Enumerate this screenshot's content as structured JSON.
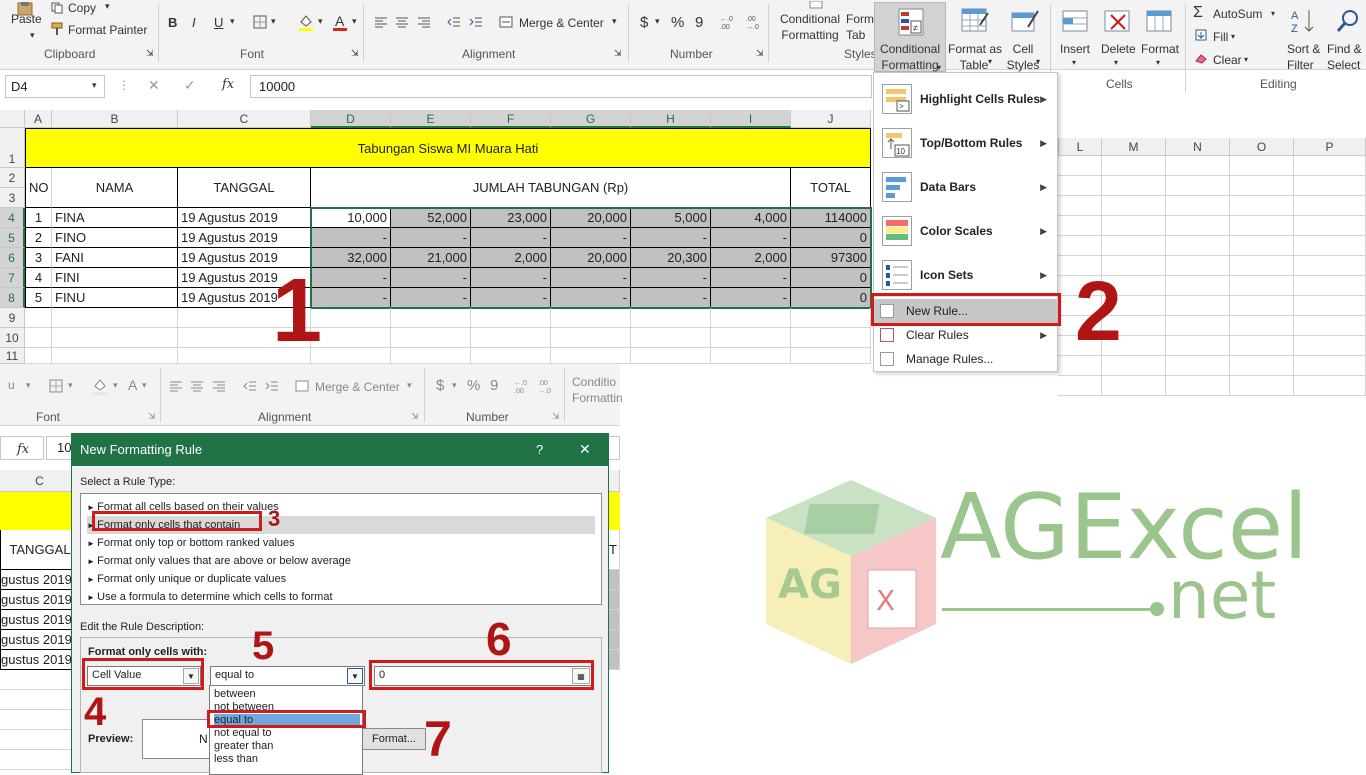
{
  "ribbon": {
    "clipboard": {
      "paste": "Paste",
      "copy": "Copy",
      "format_painter": "Format Painter",
      "label": "Clipboard"
    },
    "font": {
      "label": "Font",
      "bold": "B",
      "italic": "I",
      "underline": "U"
    },
    "alignment": {
      "merge_center": "Merge & Center",
      "label": "Alignment"
    },
    "number": {
      "currency": "$",
      "percent": "%",
      "comma": "9",
      "label": "Number"
    },
    "styles": {
      "conditional_formatting_back": "Conditional\nFormatting",
      "format_table_back": "Form\nTab",
      "label": "Styles"
    },
    "cf_button": "Conditional\nFormatting",
    "format_as_table": "Format as\nTable",
    "cell_styles": "Cell\nStyles",
    "cells": {
      "insert": "Insert",
      "delete": "Delete",
      "format": "Format",
      "label": "Cells"
    },
    "editing": {
      "autosum": "AutoSum",
      "fill": "Fill",
      "clear": "Clear",
      "sort_filter": "Sort &\nFilter",
      "find_select": "Find &\nSelect",
      "label": "Editing"
    }
  },
  "formula_bar": {
    "name_box": "D4",
    "fx": "fx",
    "value": "10000"
  },
  "columns": [
    "A",
    "B",
    "C",
    "D",
    "E",
    "F",
    "G",
    "H",
    "I",
    "J"
  ],
  "right_columns": [
    "L",
    "M",
    "N",
    "O",
    "P"
  ],
  "rows": [
    "1",
    "2",
    "3",
    "4",
    "5",
    "6",
    "7",
    "8",
    "9",
    "10",
    "11"
  ],
  "sheet": {
    "title": "Tabungan Siswa MI Muara Hati",
    "headers": {
      "no": "NO",
      "nama": "NAMA",
      "tanggal": "TANGGAL",
      "jumlah": "JUMLAH TABUNGAN (Rp)",
      "total": "TOTAL"
    },
    "data": [
      {
        "no": "1",
        "nama": "FINA",
        "tanggal": "19 Agustus 2019",
        "v": [
          "10,000",
          "52,000",
          "23,000",
          "20,000",
          "5,000",
          "4,000"
        ],
        "total": "114000"
      },
      {
        "no": "2",
        "nama": "FINO",
        "tanggal": "19 Agustus 2019",
        "v": [
          "-",
          "-",
          "-",
          "-",
          "-",
          "-"
        ],
        "total": "0"
      },
      {
        "no": "3",
        "nama": "FANI",
        "tanggal": "19 Agustus 2019",
        "v": [
          "32,000",
          "21,000",
          "2,000",
          "20,000",
          "20,300",
          "2,000"
        ],
        "total": "97300"
      },
      {
        "no": "4",
        "nama": "FINI",
        "tanggal": "19 Agustus 2019",
        "v": [
          "-",
          "-",
          "-",
          "-",
          "-",
          "-"
        ],
        "total": "0"
      },
      {
        "no": "5",
        "nama": "FINU",
        "tanggal": "19 Agustus 2019",
        "v": [
          "-",
          "-",
          "-",
          "-",
          "-",
          "-"
        ],
        "total": "0"
      }
    ]
  },
  "cf_menu": {
    "items": [
      {
        "label": "Highlight Cells Rules"
      },
      {
        "label": "Top/Bottom Rules"
      },
      {
        "label": "Data Bars"
      },
      {
        "label": "Color Scales"
      },
      {
        "label": "Icon Sets"
      }
    ],
    "new_rule": "New Rule...",
    "clear_rules": "Clear Rules",
    "manage_rules": "Manage Rules..."
  },
  "ribbon2": {
    "merge_center": "Merge & Center",
    "font_label": "Font",
    "alignment_label": "Alignment",
    "number_label": "Number",
    "cond": "Conditio\nFormattin"
  },
  "sheet2": {
    "col_c": "C",
    "tanggal": "TANGGAL",
    "dates": [
      "gustus 2019",
      "gustus 2019",
      "gustus 2019",
      "gustus 2019",
      "gustus 2019"
    ],
    "fx": "fx",
    "fx_value": "10",
    "to": "T"
  },
  "dialog": {
    "title": "New Formatting Rule",
    "help": "?",
    "close": "✕",
    "select_label": "Select a Rule Type:",
    "rule_types": [
      "Format all cells based on their values",
      "Format only cells that contain",
      "Format only top or bottom ranked values",
      "Format only values that are above or below average",
      "Format only unique or duplicate values",
      "Use a formula to determine which cells to format"
    ],
    "edit_label": "Edit the Rule Description:",
    "format_only_label": "Format only cells with:",
    "cell_value": "Cell Value",
    "operator": "equal to",
    "value": "0",
    "preview_label": "Preview:",
    "preview_text": "N",
    "format_button": "Format...",
    "operator_options": [
      "between",
      "not between",
      "equal to",
      "not equal to",
      "greater than",
      "less than"
    ]
  },
  "annotations": [
    "1",
    "2",
    "3",
    "4",
    "5",
    "6",
    "7"
  ],
  "logo": {
    "main": "AGExcel",
    "sub": "net",
    "cube_letters": "AG"
  },
  "colors": {
    "excel_green": "#217346",
    "red": "#d01b1b",
    "yellow": "#ffff00",
    "gray": "#c0c0c0",
    "logo_green": "#9bc58d"
  }
}
